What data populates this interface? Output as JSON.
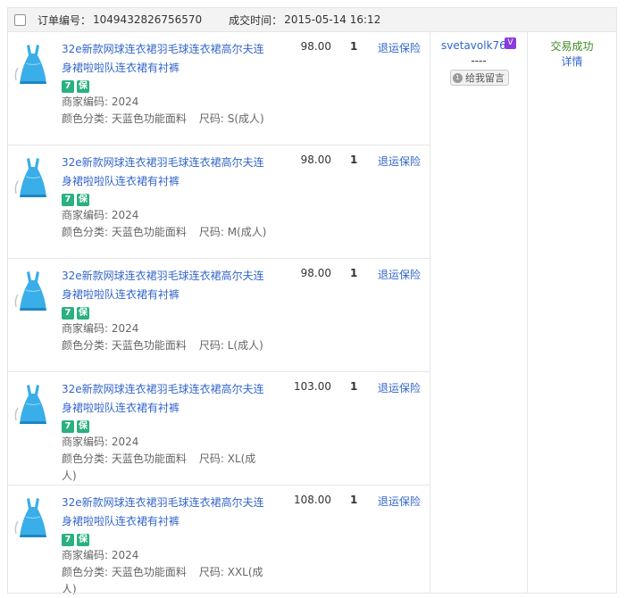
{
  "order": {
    "number_label": "订单编号：",
    "number": "1049432826756570",
    "time_label": "成交时间：",
    "time": "2015-05-14 16:12"
  },
  "items": [
    {
      "title": "32e新款网球连衣裙羽毛球连衣裙高尔夫连身裙啦啦队连衣裙有衬裤",
      "badge1": "7",
      "badge2": "保",
      "merchant_code": "商家编码: 2024",
      "color_label": "颜色分类: 天蓝色功能面料",
      "size_label": "尺码: S(成人)",
      "price": "98.00",
      "qty": "1",
      "insurance": "退运保险"
    },
    {
      "title": "32e新款网球连衣裙羽毛球连衣裙高尔夫连身裙啦啦队连衣裙有衬裤",
      "badge1": "7",
      "badge2": "保",
      "merchant_code": "商家编码: 2024",
      "color_label": "颜色分类: 天蓝色功能面料",
      "size_label": "尺码: M(成人)",
      "price": "98.00",
      "qty": "1",
      "insurance": "退运保险"
    },
    {
      "title": "32e新款网球连衣裙羽毛球连衣裙高尔夫连身裙啦啦队连衣裙有衬裤",
      "badge1": "7",
      "badge2": "保",
      "merchant_code": "商家编码: 2024",
      "color_label": "颜色分类: 天蓝色功能面料",
      "size_label": "尺码: L(成人)",
      "price": "98.00",
      "qty": "1",
      "insurance": "退运保险"
    },
    {
      "title": "32e新款网球连衣裙羽毛球连衣裙高尔夫连身裙啦啦队连衣裙有衬裤",
      "badge1": "7",
      "badge2": "保",
      "merchant_code": "商家编码: 2024",
      "color_label": "颜色分类: 天蓝色功能面料",
      "size_label": "尺码: XL(成人)",
      "price": "103.00",
      "qty": "1",
      "insurance": "退运保险"
    },
    {
      "title": "32e新款网球连衣裙羽毛球连衣裙高尔夫连身裙啦啦队连衣裙有衬裤",
      "badge1": "7",
      "badge2": "保",
      "merchant_code": "商家编码: 2024",
      "color_label": "颜色分类: 天蓝色功能面料",
      "size_label": "尺码: XXL(成人)",
      "price": "108.00",
      "qty": "1",
      "insurance": "退运保险"
    }
  ],
  "buyer": {
    "name": "svetavolk76",
    "vip_badge": "V",
    "dash": "----",
    "message_button": "给我留言",
    "message_icon": "speech-bubble-icon"
  },
  "status": {
    "state": "交易成功",
    "details_link": "详情"
  },
  "colors": {
    "link": "#3366cc",
    "success": "#3a8a1e",
    "badge_green": "#2bb07f",
    "dress": "#3aaee8",
    "header_bg": "#f3f3f3"
  }
}
